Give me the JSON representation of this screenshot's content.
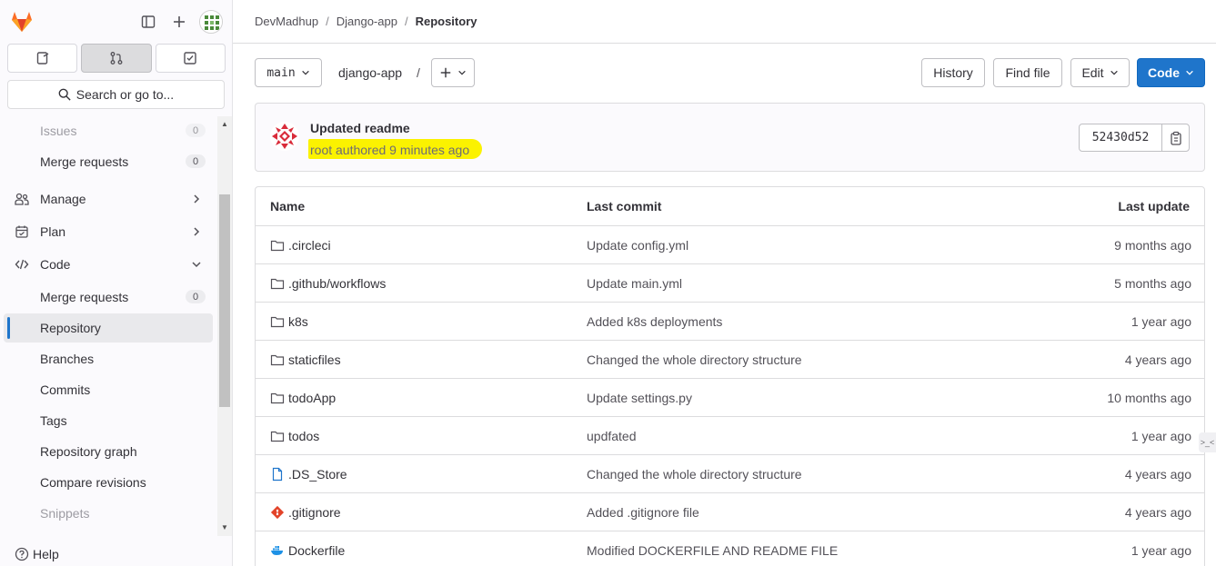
{
  "sidebar": {
    "search_label": "Search or go to...",
    "items": [
      {
        "label": "Issues",
        "count": "0"
      },
      {
        "label": "Merge requests",
        "count": "0"
      },
      {
        "label": "Manage"
      },
      {
        "label": "Plan"
      },
      {
        "label": "Code"
      },
      {
        "label": "Merge requests",
        "count": "0"
      },
      {
        "label": "Repository"
      },
      {
        "label": "Branches"
      },
      {
        "label": "Commits"
      },
      {
        "label": "Tags"
      },
      {
        "label": "Repository graph"
      },
      {
        "label": "Compare revisions"
      },
      {
        "label": "Snippets"
      }
    ],
    "help_label": "Help"
  },
  "breadcrumb": [
    "DevMadhup",
    "Django-app",
    "Repository"
  ],
  "toolbar": {
    "branch": "main",
    "path": "django-app",
    "path_sep": "/",
    "history": "History",
    "find_file": "Find file",
    "edit": "Edit",
    "code": "Code"
  },
  "commit": {
    "title": "Updated readme",
    "meta": "root authored 9 minutes ago",
    "sha": "52430d52"
  },
  "table": {
    "headers": {
      "name": "Name",
      "last_commit": "Last commit",
      "last_update": "Last update"
    },
    "rows": [
      {
        "name": ".circleci",
        "type": "folder",
        "commit": "Update config.yml",
        "when": "9 months ago"
      },
      {
        "name": ".github/workflows",
        "type": "folder",
        "commit": "Update main.yml",
        "when": "5 months ago"
      },
      {
        "name": "k8s",
        "type": "folder",
        "commit": "Added k8s deployments",
        "when": "1 year ago"
      },
      {
        "name": "staticfiles",
        "type": "folder",
        "commit": "Changed the whole directory structure",
        "when": "4 years ago"
      },
      {
        "name": "todoApp",
        "type": "folder",
        "commit": "Update settings.py",
        "when": "10 months ago"
      },
      {
        "name": "todos",
        "type": "folder",
        "commit": "updfated",
        "when": "1 year ago"
      },
      {
        "name": ".DS_Store",
        "type": "file",
        "commit": "Changed the whole directory structure",
        "when": "4 years ago"
      },
      {
        "name": ".gitignore",
        "type": "git",
        "commit": "Added .gitignore file",
        "when": "4 years ago"
      },
      {
        "name": "Dockerfile",
        "type": "docker",
        "commit": "Modified DOCKERFILE AND README FILE",
        "when": "1 year ago"
      }
    ]
  },
  "colors": {
    "accent": "#1f75cb",
    "highlight": "#fbf200",
    "brand": "#e24329"
  }
}
